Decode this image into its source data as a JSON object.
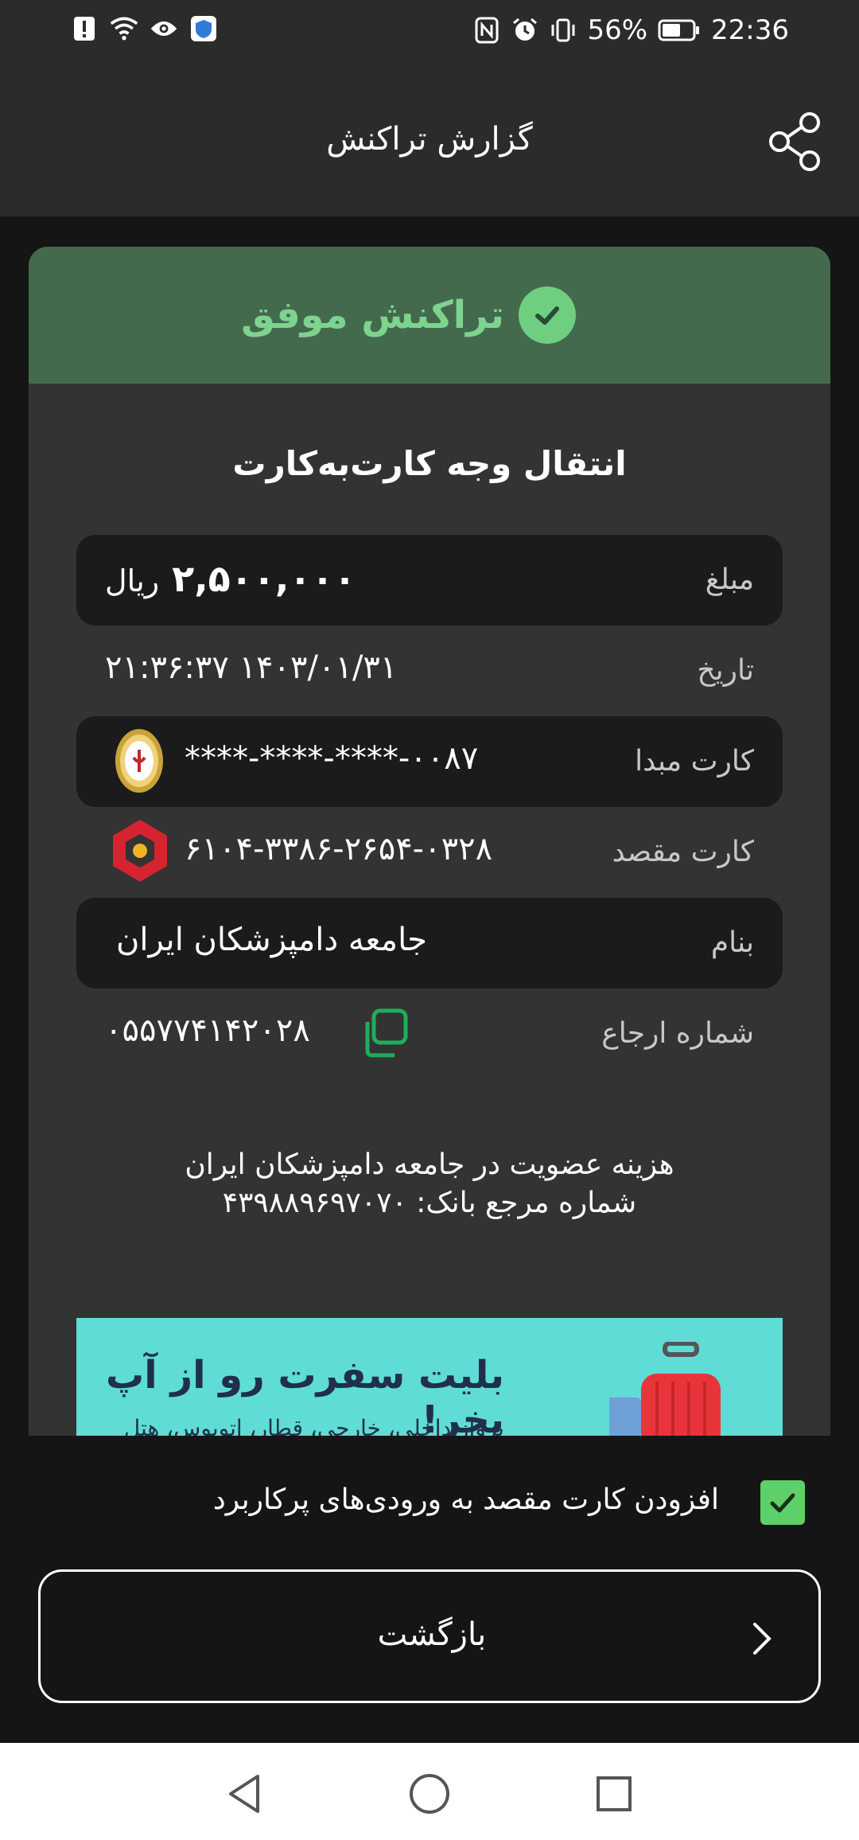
{
  "status_bar": {
    "battery": "56%",
    "time": "22:36"
  },
  "app_bar": {
    "title": "گزارش تراکنش"
  },
  "result": {
    "status": "تراکنش موفق",
    "transaction_type": "انتقال وجه کارت‌به‌کارت"
  },
  "details": {
    "amount_label": "مبلغ",
    "amount_value": "۲,۵۰۰,۰۰۰",
    "amount_unit": "ریال",
    "date_label": "تاریخ",
    "date_value": "۲۱:۳۶:۳۷ ۱۴۰۳/۰۱/۳۱",
    "source_label": "کارت مبدا",
    "source_value": "****-****-****-۰۰۸۷",
    "dest_label": "کارت مقصد",
    "dest_value": "۶۱۰۴-۳۳۸۶-۲۶۵۴-۰۳۲۸",
    "name_label": "بنام",
    "name_value": "جامعه دامپزشکان ایران",
    "ref_label": "شماره ارجاع",
    "ref_value": "۰۵۵۷۷۴۱۴۲۰۲۸"
  },
  "note": {
    "line1": "هزینه عضویت در جامعه دامپزشکان ایران",
    "line2": "شماره مرجع بانک: ۴۳۹۸۸۹۶۹۷۰۷۰"
  },
  "banner": {
    "headline": "بلیت سفرت رو از آپ بخر!",
    "sub": "پرواز داخلی، خارجی، قطار، اتوبوس، هتل"
  },
  "add_favorite": {
    "label": "افزودن کارت مقصد به ورودی‌های پرکاربرد",
    "checked": true
  },
  "back_button": {
    "label": "بازگشت"
  },
  "colors": {
    "success_bg": "#446a4e",
    "success_text": "#7ed38e",
    "checkbox": "#5fd069"
  }
}
